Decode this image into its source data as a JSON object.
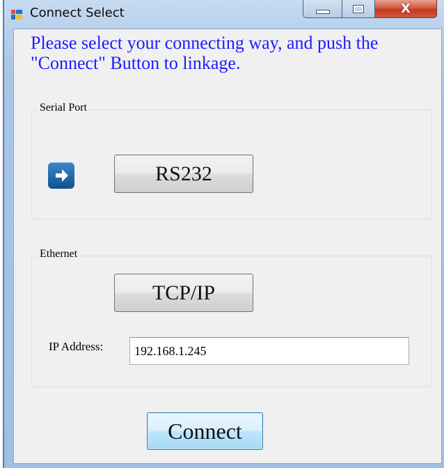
{
  "window": {
    "title": "Connect Select",
    "close_glyph": "X"
  },
  "instructions": "Please select your connecting way, and push the \"Connect\" Button to linkage.",
  "serial_group": {
    "label": "Serial Port",
    "button_label": "RS232",
    "arrow_icon": "right-arrow-icon"
  },
  "ethernet_group": {
    "label": "Ethernet",
    "button_label": "TCP/IP",
    "ip_label": "IP Address:",
    "ip_value": "192.168.1.245"
  },
  "connect_button": "Connect",
  "colors": {
    "instruction_text": "#1c1cff",
    "selected_arrow": "#1a5fa3",
    "close_button": "#c94a31"
  }
}
